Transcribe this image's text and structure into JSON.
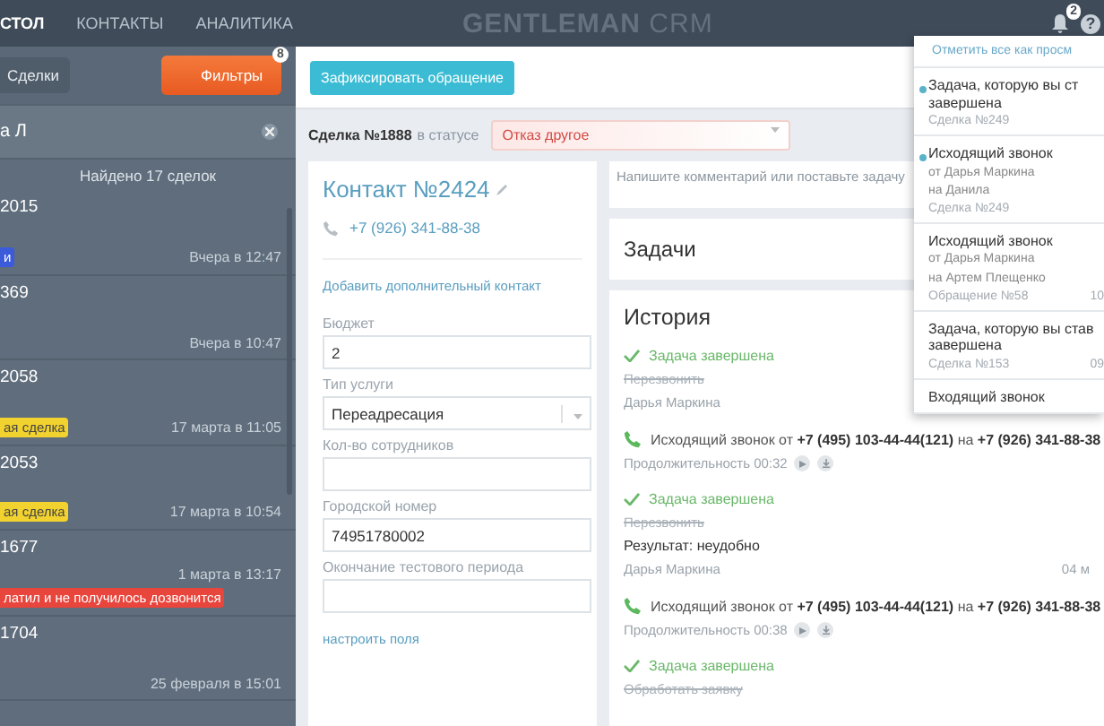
{
  "navbar": {
    "items": [
      {
        "label": "СТОЛ",
        "selected": true
      },
      {
        "label": "КОНТАКТЫ",
        "selected": false
      },
      {
        "label": "АНАЛИТИКА",
        "selected": false
      }
    ],
    "logo": "GENTLEMAN",
    "logo_suffix": "CRM",
    "bell_badge": "2",
    "help": "?"
  },
  "sidebar": {
    "deals_button": "Сделки",
    "filters_button": "Фильтры",
    "filters_badge": "8",
    "search_value": "а Л",
    "found": "Найдено 17 сделок",
    "deals": [
      {
        "title": "2015",
        "tag": "и",
        "color": "#3b5bdb",
        "time": "Вчера в 12:47"
      },
      {
        "title": "369",
        "time": "Вчера в 10:47"
      },
      {
        "title": "2058",
        "tag": "ая сделка",
        "color": "#f2d22e",
        "time": "17 марта в 11:05"
      },
      {
        "title": "2053",
        "tag": "ая сделка",
        "color": "#f2d22e",
        "time": "17 марта в 10:54"
      },
      {
        "title": "1677",
        "tag": "латил и не получилось дозвонится",
        "color": "#e8453c",
        "time": "1 марта в 13:17"
      },
      {
        "title": "1704",
        "time": "25 февраля в 15:01"
      }
    ]
  },
  "main": {
    "fix_button": "Зафиксировать обращение",
    "deal_label": "Сделка №1888",
    "status_prefix": "в статусе",
    "status": "Отказ другое",
    "contact": {
      "title": "Контакт №2424",
      "phone": "+7 (926) 341-88-38",
      "add_link": "Добавить дополнительный контакт",
      "fields": [
        {
          "kind": "text",
          "label": "Бюджет",
          "value": "2"
        },
        {
          "kind": "select",
          "label": "Тип услуги",
          "value": "Переадресация"
        },
        {
          "kind": "text",
          "label": "Кол-во сотрудников"
        },
        {
          "kind": "text",
          "label": "Городской номер",
          "value": "74951780002"
        },
        {
          "kind": "text",
          "label": "Окончание тестового периода"
        }
      ],
      "settings_link": "настроить поля"
    },
    "comment_placeholder": "Напишите комментарий или поставьте задачу",
    "tasks_title": "Задачи",
    "history_title": "История",
    "history": [
      {
        "kind": "task",
        "title": "Задача завершена",
        "task": "Перезвонить",
        "author": "Дарья Маркина"
      },
      {
        "kind": "call",
        "text": "Исходящий звонок от **+7 (495) 103-44-44(121)** на **+7 (926) 341-88-38**",
        "duration": "Продолжительность 00:32"
      },
      {
        "kind": "task",
        "title": "Задача завершена",
        "task": "Перезвонить",
        "result": "Результат: неудобно",
        "author": "Дарья Маркина",
        "date": "04 м"
      },
      {
        "kind": "call",
        "text": "Исходящий звонок от **+7 (495) 103-44-44(121)** на **+7 (926) 341-88-38**",
        "duration": "Продолжительность 00:38"
      },
      {
        "kind": "task",
        "title": "Задача завершена",
        "task": "Обработать заявку"
      }
    ]
  },
  "notifications": {
    "mark_all": "Отметить все как просм",
    "items": [
      {
        "unread": true,
        "title": [
          "Задача, которую вы ст",
          "завершена"
        ],
        "ref": "Сделка №249"
      },
      {
        "unread": true,
        "title": [
          "Исходящий звонок"
        ],
        "lines": [
          "от Дарья Маркина",
          "на Данила"
        ],
        "ref": "Сделка №249"
      },
      {
        "unread": false,
        "title": [
          "Исходящий звонок"
        ],
        "lines": [
          "от Дарья Маркина",
          "на Артем Плещенко"
        ],
        "ref": "Обращение №58",
        "time": "10"
      },
      {
        "unread": false,
        "title": [
          "Задача, которую вы став",
          "завершена"
        ],
        "ref": "Сделка №153",
        "time": "09"
      },
      {
        "unread": false,
        "title": [
          "Входящий звонок"
        ]
      }
    ]
  }
}
